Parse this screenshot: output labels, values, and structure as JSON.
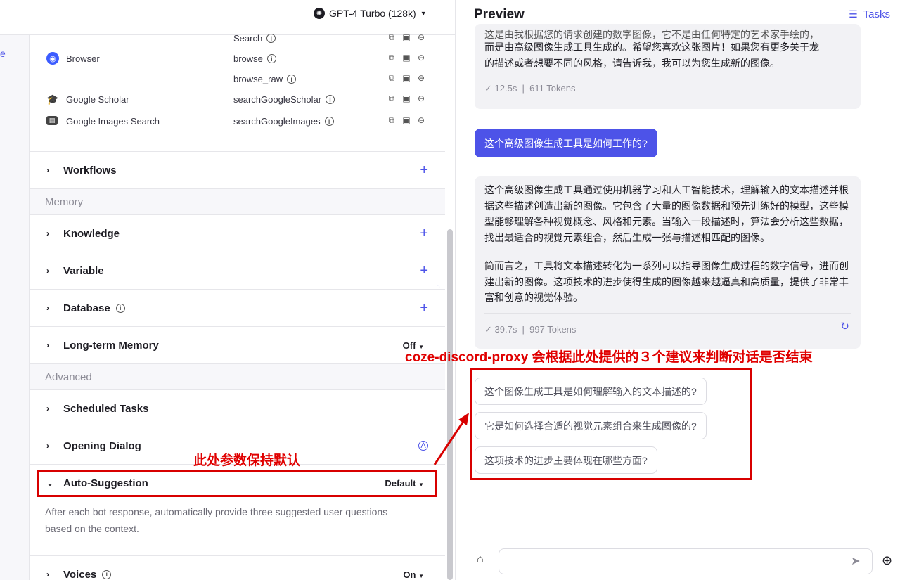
{
  "header": {
    "model_label": "GPT-4 Turbo (128k)",
    "left_stub": "e"
  },
  "plugins": [
    {
      "tool": "Search",
      "plugin": "",
      "icon": ""
    },
    {
      "tool": "browse",
      "plugin": "Browser",
      "icon": "browser-icon"
    },
    {
      "tool": "browse_raw",
      "plugin": "",
      "icon": ""
    },
    {
      "tool": "searchGoogleScholar",
      "plugin": "Google Scholar",
      "icon": "scholar-icon"
    },
    {
      "tool": "searchGoogleImages",
      "plugin": "Google Images Search",
      "icon": "images-icon"
    }
  ],
  "sections": {
    "workflows": "Workflows",
    "memory_group": "Memory",
    "knowledge": "Knowledge",
    "variable": "Variable",
    "database": "Database",
    "long_term_memory": "Long-term Memory",
    "long_term_memory_value": "Off",
    "advanced_group": "Advanced",
    "scheduled_tasks": "Scheduled Tasks",
    "opening_dialog": "Opening Dialog",
    "auto_suggestion": "Auto-Suggestion",
    "auto_suggestion_value": "Default",
    "auto_suggestion_desc": "After each bot response, automatically provide three suggested user questions based on the context.",
    "voices": "Voices",
    "voices_value": "On"
  },
  "preview": {
    "title": "Preview",
    "tasks_label": "Tasks",
    "msg1_partial": "这是由我根据您的请求创建的数字图像，它不是由任何特定的艺术家手绘的，",
    "msg1_line2": "而是由高级图像生成工具生成的。希望您喜欢这张图片！如果您有更多关于龙",
    "msg1_line3": "的描述或者想要不同的风格，请告诉我，我可以为您生成新的图像。",
    "msg1_time": "12.5s",
    "msg1_tokens": "611 Tokens",
    "user_msg": "这个高级图像生成工具是如何工作的?",
    "msg2_p1": "这个高级图像生成工具通过使用机器学习和人工智能技术，理解输入的文本描述并根据这些描述创造出新的图像。它包含了大量的图像数据和预先训练好的模型，这些模型能够理解各种视觉概念、风格和元素。当输入一段描述时，算法会分析这些数据，找出最适合的视觉元素组合，然后生成一张与描述相匹配的图像。",
    "msg2_p2": "简而言之，工具将文本描述转化为一系列可以指导图像生成过程的数字信号，进而创建出新的图像。这项技术的进步使得生成的图像越来越逼真和高质量，提供了非常丰富和创意的视觉体验。",
    "msg2_time": "39.7s",
    "msg2_tokens": "997 Tokens",
    "suggestions": [
      "这个图像生成工具是如何理解输入的文本描述的?",
      "它是如何选择合适的视觉元素组合来生成图像的?",
      "这项技术的进步主要体现在哪些方面?"
    ]
  },
  "annotations": {
    "top": "coze-discord-proxy 会根据此处提供的３个建议来判断对话是否结束",
    "left": "此处参数保持默认"
  }
}
